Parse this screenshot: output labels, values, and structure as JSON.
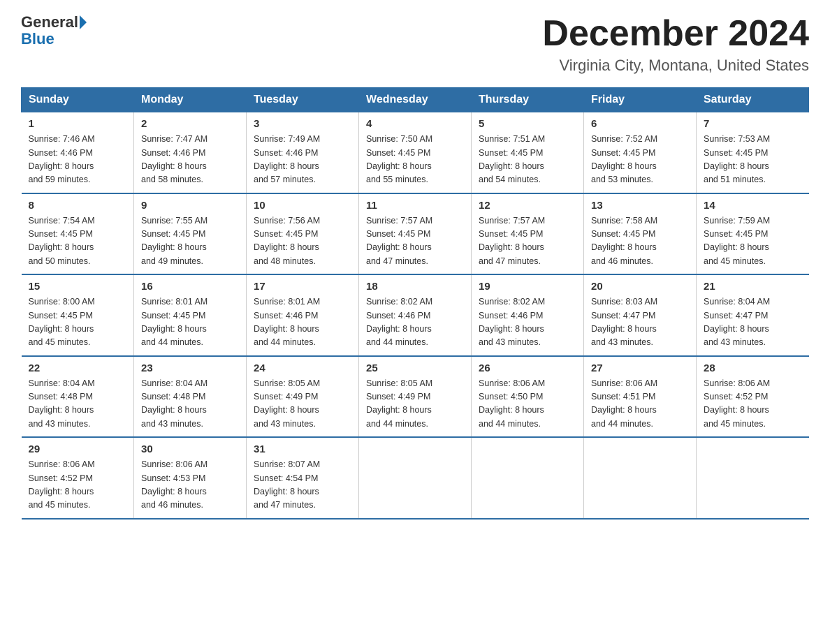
{
  "header": {
    "logo_general": "General",
    "logo_blue": "Blue",
    "month_title": "December 2024",
    "location": "Virginia City, Montana, United States"
  },
  "days_of_week": [
    "Sunday",
    "Monday",
    "Tuesday",
    "Wednesday",
    "Thursday",
    "Friday",
    "Saturday"
  ],
  "weeks": [
    [
      {
        "day": "1",
        "sunrise": "7:46 AM",
        "sunset": "4:46 PM",
        "daylight": "8 hours and 59 minutes."
      },
      {
        "day": "2",
        "sunrise": "7:47 AM",
        "sunset": "4:46 PM",
        "daylight": "8 hours and 58 minutes."
      },
      {
        "day": "3",
        "sunrise": "7:49 AM",
        "sunset": "4:46 PM",
        "daylight": "8 hours and 57 minutes."
      },
      {
        "day": "4",
        "sunrise": "7:50 AM",
        "sunset": "4:45 PM",
        "daylight": "8 hours and 55 minutes."
      },
      {
        "day": "5",
        "sunrise": "7:51 AM",
        "sunset": "4:45 PM",
        "daylight": "8 hours and 54 minutes."
      },
      {
        "day": "6",
        "sunrise": "7:52 AM",
        "sunset": "4:45 PM",
        "daylight": "8 hours and 53 minutes."
      },
      {
        "day": "7",
        "sunrise": "7:53 AM",
        "sunset": "4:45 PM",
        "daylight": "8 hours and 51 minutes."
      }
    ],
    [
      {
        "day": "8",
        "sunrise": "7:54 AM",
        "sunset": "4:45 PM",
        "daylight": "8 hours and 50 minutes."
      },
      {
        "day": "9",
        "sunrise": "7:55 AM",
        "sunset": "4:45 PM",
        "daylight": "8 hours and 49 minutes."
      },
      {
        "day": "10",
        "sunrise": "7:56 AM",
        "sunset": "4:45 PM",
        "daylight": "8 hours and 48 minutes."
      },
      {
        "day": "11",
        "sunrise": "7:57 AM",
        "sunset": "4:45 PM",
        "daylight": "8 hours and 47 minutes."
      },
      {
        "day": "12",
        "sunrise": "7:57 AM",
        "sunset": "4:45 PM",
        "daylight": "8 hours and 47 minutes."
      },
      {
        "day": "13",
        "sunrise": "7:58 AM",
        "sunset": "4:45 PM",
        "daylight": "8 hours and 46 minutes."
      },
      {
        "day": "14",
        "sunrise": "7:59 AM",
        "sunset": "4:45 PM",
        "daylight": "8 hours and 45 minutes."
      }
    ],
    [
      {
        "day": "15",
        "sunrise": "8:00 AM",
        "sunset": "4:45 PM",
        "daylight": "8 hours and 45 minutes."
      },
      {
        "day": "16",
        "sunrise": "8:01 AM",
        "sunset": "4:45 PM",
        "daylight": "8 hours and 44 minutes."
      },
      {
        "day": "17",
        "sunrise": "8:01 AM",
        "sunset": "4:46 PM",
        "daylight": "8 hours and 44 minutes."
      },
      {
        "day": "18",
        "sunrise": "8:02 AM",
        "sunset": "4:46 PM",
        "daylight": "8 hours and 44 minutes."
      },
      {
        "day": "19",
        "sunrise": "8:02 AM",
        "sunset": "4:46 PM",
        "daylight": "8 hours and 43 minutes."
      },
      {
        "day": "20",
        "sunrise": "8:03 AM",
        "sunset": "4:47 PM",
        "daylight": "8 hours and 43 minutes."
      },
      {
        "day": "21",
        "sunrise": "8:04 AM",
        "sunset": "4:47 PM",
        "daylight": "8 hours and 43 minutes."
      }
    ],
    [
      {
        "day": "22",
        "sunrise": "8:04 AM",
        "sunset": "4:48 PM",
        "daylight": "8 hours and 43 minutes."
      },
      {
        "day": "23",
        "sunrise": "8:04 AM",
        "sunset": "4:48 PM",
        "daylight": "8 hours and 43 minutes."
      },
      {
        "day": "24",
        "sunrise": "8:05 AM",
        "sunset": "4:49 PM",
        "daylight": "8 hours and 43 minutes."
      },
      {
        "day": "25",
        "sunrise": "8:05 AM",
        "sunset": "4:49 PM",
        "daylight": "8 hours and 44 minutes."
      },
      {
        "day": "26",
        "sunrise": "8:06 AM",
        "sunset": "4:50 PM",
        "daylight": "8 hours and 44 minutes."
      },
      {
        "day": "27",
        "sunrise": "8:06 AM",
        "sunset": "4:51 PM",
        "daylight": "8 hours and 44 minutes."
      },
      {
        "day": "28",
        "sunrise": "8:06 AM",
        "sunset": "4:52 PM",
        "daylight": "8 hours and 45 minutes."
      }
    ],
    [
      {
        "day": "29",
        "sunrise": "8:06 AM",
        "sunset": "4:52 PM",
        "daylight": "8 hours and 45 minutes."
      },
      {
        "day": "30",
        "sunrise": "8:06 AM",
        "sunset": "4:53 PM",
        "daylight": "8 hours and 46 minutes."
      },
      {
        "day": "31",
        "sunrise": "8:07 AM",
        "sunset": "4:54 PM",
        "daylight": "8 hours and 47 minutes."
      },
      null,
      null,
      null,
      null
    ]
  ],
  "labels": {
    "sunrise": "Sunrise:",
    "sunset": "Sunset:",
    "daylight": "Daylight:"
  }
}
